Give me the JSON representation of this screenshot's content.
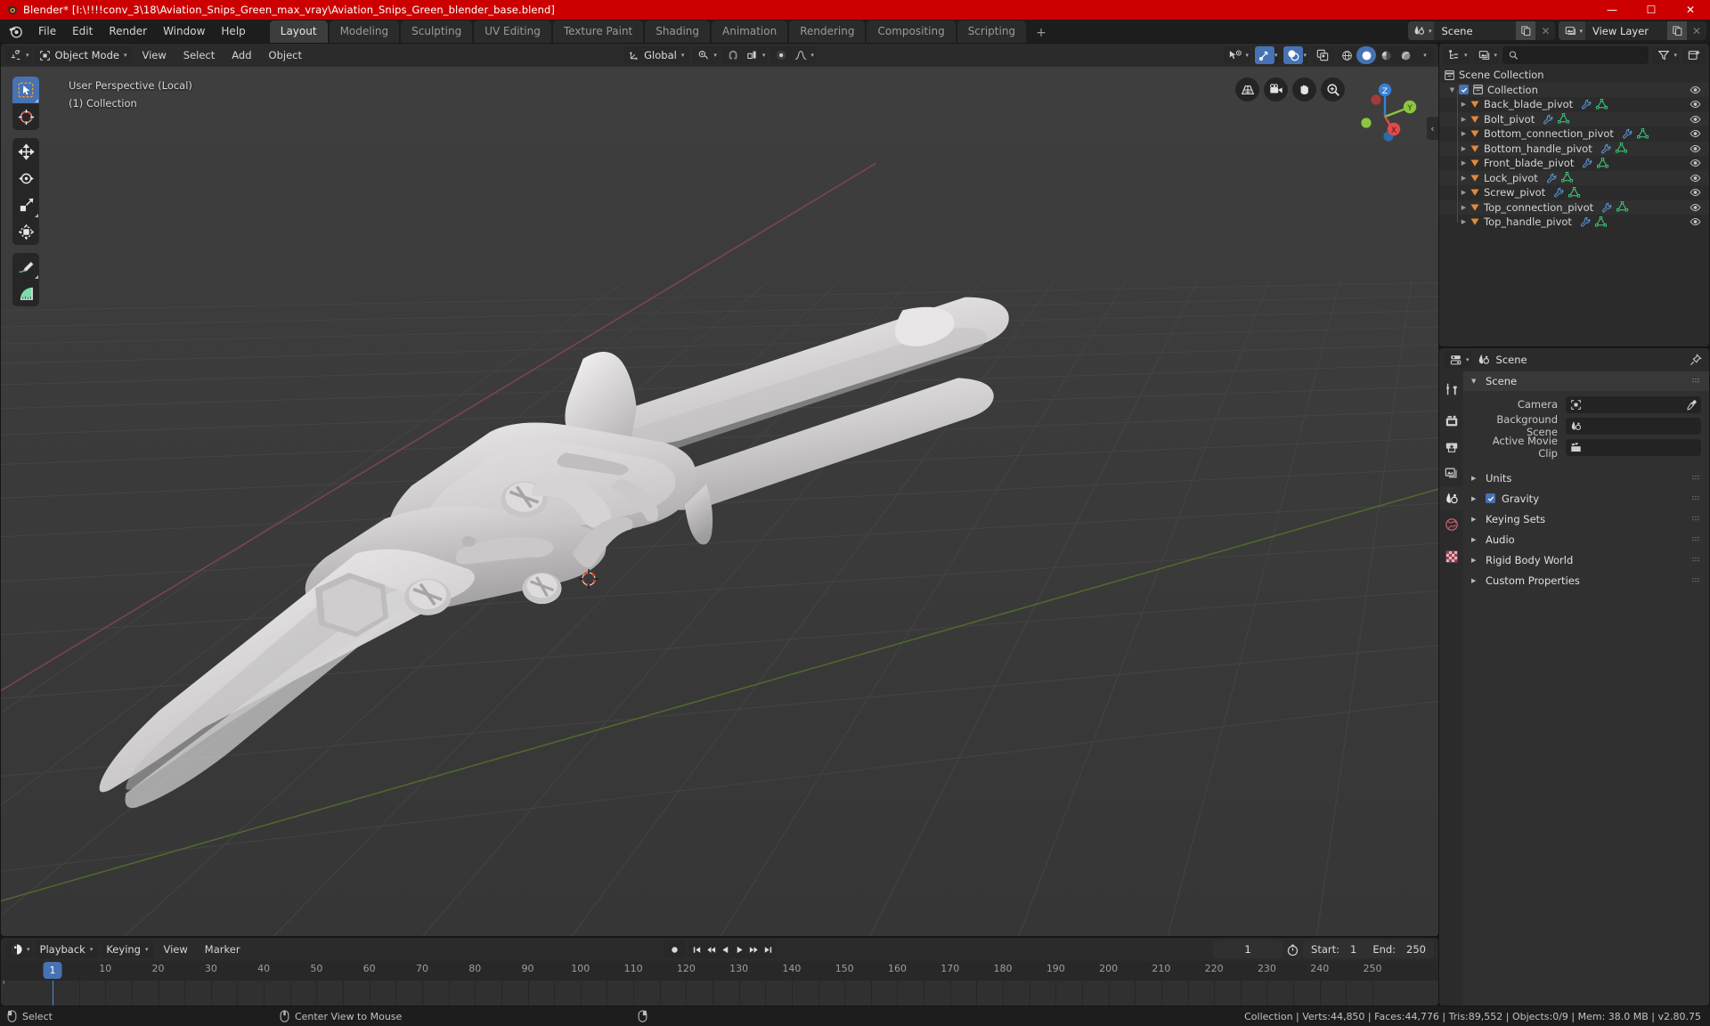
{
  "window": {
    "title": "Blender* [I:\\!!!!conv_3\\18\\Aviation_Snips_Green_max_vray\\Aviation_Snips_Green_blender_base.blend]",
    "minimize": "—",
    "maximize": "☐",
    "close": "✕"
  },
  "topbar": {
    "menus": [
      "File",
      "Edit",
      "Render",
      "Window",
      "Help"
    ],
    "workspaces": [
      {
        "label": "Layout",
        "active": true
      },
      {
        "label": "Modeling",
        "active": false
      },
      {
        "label": "Sculpting",
        "active": false
      },
      {
        "label": "UV Editing",
        "active": false
      },
      {
        "label": "Texture Paint",
        "active": false
      },
      {
        "label": "Shading",
        "active": false
      },
      {
        "label": "Animation",
        "active": false
      },
      {
        "label": "Rendering",
        "active": false
      },
      {
        "label": "Compositing",
        "active": false
      },
      {
        "label": "Scripting",
        "active": false
      }
    ],
    "add_workspace": "+",
    "scene_name": "Scene",
    "view_layer_name": "View Layer"
  },
  "viewport_header": {
    "mode": "Object Mode",
    "menus": [
      "View",
      "Select",
      "Add",
      "Object"
    ],
    "transform_orientation": "Global",
    "snap_chevron": "▾"
  },
  "viewport": {
    "perspective_label": "User Perspective (Local)",
    "collection_label": "(1) Collection",
    "gizmo_axes": {
      "z": "Z",
      "y": "Y",
      "x": "X"
    },
    "tools": [
      {
        "name": "tweak-select-tool",
        "active": true
      },
      {
        "name": "cursor-tool",
        "active": false
      },
      {
        "name": "move-tool",
        "active": false
      },
      {
        "name": "rotate-tool",
        "active": false
      },
      {
        "name": "scale-tool",
        "active": false
      },
      {
        "name": "transform-tool",
        "active": false
      },
      {
        "name": "annotate-tool",
        "active": false
      },
      {
        "name": "measure-tool",
        "active": false
      }
    ],
    "nav_icons": [
      "grid-toggle-icon",
      "camera-view-icon",
      "hand-pan-icon",
      "zoom-icon"
    ],
    "sidebar_arrow": "‹"
  },
  "outliner": {
    "search_placeholder": "",
    "root": "Scene Collection",
    "collection": "Collection",
    "items": [
      {
        "label": "Back_blade_pivot"
      },
      {
        "label": "Bolt_pivot"
      },
      {
        "label": "Bottom_connection_pivot"
      },
      {
        "label": "Bottom_handle_pivot"
      },
      {
        "label": "Front_blade_pivot"
      },
      {
        "label": "Lock_pivot"
      },
      {
        "label": "Screw_pivot"
      },
      {
        "label": "Top_connection_pivot"
      },
      {
        "label": "Top_handle_pivot"
      }
    ]
  },
  "properties": {
    "header_title": "Scene",
    "panel_title": "Scene",
    "fields": [
      {
        "label": "Camera",
        "value": "",
        "icon": "camera-data-icon",
        "eyedropper": true
      },
      {
        "label": "Background Scene",
        "value": "",
        "icon": "scene-icon",
        "eyedropper": false
      },
      {
        "label": "Active Movie Clip",
        "value": "",
        "icon": "clip-icon",
        "eyedropper": false
      }
    ],
    "sections": [
      {
        "label": "Units",
        "checkbox": false
      },
      {
        "label": "Gravity",
        "checkbox": true
      },
      {
        "label": "Keying Sets",
        "checkbox": false
      },
      {
        "label": "Audio",
        "checkbox": false
      },
      {
        "label": "Rigid Body World",
        "checkbox": false
      },
      {
        "label": "Custom Properties",
        "checkbox": false
      }
    ],
    "tabs": [
      {
        "name": "tool-tab",
        "active": false
      },
      {
        "name": "render-tab",
        "active": false
      },
      {
        "name": "output-tab",
        "active": false
      },
      {
        "name": "view-layer-tab",
        "active": false
      },
      {
        "name": "scene-tab",
        "active": true
      },
      {
        "name": "world-tab",
        "active": false
      },
      {
        "name": "texture-tab",
        "active": false
      }
    ]
  },
  "timeline": {
    "editor_menu_chevron": "▾",
    "menus": [
      "Playback",
      "Keying",
      "View",
      "Marker"
    ],
    "current_frame": "1",
    "start_label": "Start:",
    "start_value": "1",
    "end_label": "End:",
    "end_value": "250",
    "ticks": [
      "1",
      "10",
      "20",
      "30",
      "40",
      "50",
      "60",
      "70",
      "80",
      "90",
      "100",
      "110",
      "120",
      "130",
      "140",
      "150",
      "160",
      "170",
      "180",
      "190",
      "200",
      "210",
      "220",
      "230",
      "240",
      "250"
    ],
    "expand_arrow": "›"
  },
  "statusbar": {
    "hints": [
      {
        "icon": "mouse-left-icon",
        "label": "Select"
      },
      {
        "icon": "mouse-middle-icon",
        "label": "Center View to Mouse"
      },
      {
        "icon": "mouse-right-icon",
        "label": ""
      }
    ],
    "stats": "Collection | Verts:44,850 | Faces:44,776 | Tris:89,552 | Objects:0/9 | Mem: 38.0 MB | v2.80.75"
  },
  "colors": {
    "title_bar": "#cc0000",
    "accent_blue": "#4772b3",
    "object_orange": "#e08a3c",
    "mesh_green": "#3fd07f",
    "modifier_blue": "#5b9ae0",
    "axis_x": "#e14a4a",
    "axis_y": "#8cc63f",
    "axis_z": "#3b7fd4"
  }
}
